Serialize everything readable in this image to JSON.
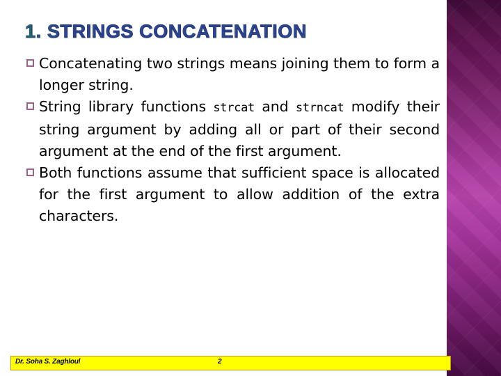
{
  "slide": {
    "title": "1. STRINGS CONCATENATION",
    "title_number_part": "1.",
    "title_colors": {
      "gradient_start": "#2f9c7e",
      "gradient_end": "#4169c8",
      "outline": "#1a235c"
    },
    "background_color": "#ffffff",
    "bullets": [
      {
        "marker": "hollow-square-bullet",
        "segments": [
          {
            "text": "Concatenating two strings means joining them to form a longer string.",
            "style": "normal"
          }
        ]
      },
      {
        "marker": "hollow-square-bullet",
        "segments": [
          {
            "text": "String library functions ",
            "style": "normal"
          },
          {
            "text": "strcat",
            "style": "code"
          },
          {
            "text": " and ",
            "style": "normal"
          },
          {
            "text": "strncat",
            "style": "code"
          },
          {
            "text": " modify their string argument by adding all or part of their second argument at the end of the first argument.",
            "style": "normal"
          }
        ]
      },
      {
        "marker": "hollow-square-bullet",
        "segments": [
          {
            "text": "Both functions assume that sufficient space is allocated for the first argument to allow addition of the extra characters.",
            "style": "normal"
          }
        ]
      }
    ]
  },
  "decoration": {
    "side_band_name": "purple-gradient-band",
    "side_band_top_color": "#400c38",
    "side_band_mid_color": "#b845ab",
    "side_band_bottom_color": "#470c44",
    "bullet_marker_color": "#9d5f8c"
  },
  "footer": {
    "author": "Dr. Soha S. Zaghloul",
    "page_number": "2",
    "bar_color": "#ffff00",
    "bar_border_color": "#c89a16",
    "text_color": "#000000"
  }
}
